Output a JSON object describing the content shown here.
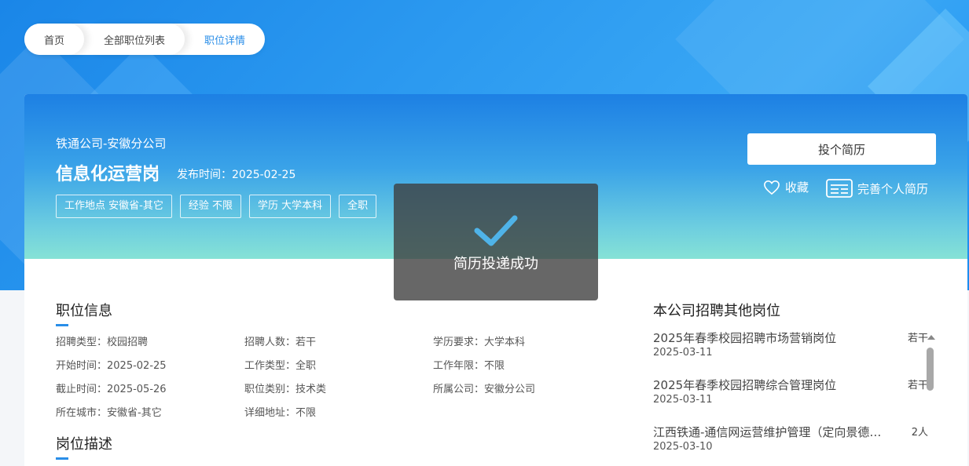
{
  "breadcrumb": {
    "home": "首页",
    "list": "全部职位列表",
    "detail": "职位详情"
  },
  "job": {
    "company": "铁通公司-安徽分公司",
    "title": "信息化运营岗",
    "publish": "发布时间：2025-02-25",
    "tags": [
      "工作地点 安徽省-其它",
      "经验 不限",
      "学历 大学本科",
      "全职"
    ]
  },
  "actions": {
    "apply": "投个简历",
    "favorite": "收藏",
    "resume": "完善个人简历"
  },
  "toast": {
    "text": "简历投递成功",
    "icon": "check-icon"
  },
  "info": {
    "title": "职位信息",
    "cells": [
      "招聘类型：校园招聘",
      "招聘人数：若干",
      "学历要求：大学本科",
      "开始时间：2025-02-25",
      "工作类型：全职",
      "工作年限：不限",
      "截止时间：2025-05-26",
      "职位类别：技术类",
      "所属公司：安徽分公司",
      "所在城市：安徽省-其它",
      "详细地址：不限",
      ""
    ]
  },
  "description": {
    "title": "岗位描述"
  },
  "others": {
    "title": "本公司招聘其他岗位",
    "items": [
      {
        "name": "2025年春季校园招聘市场营销岗位",
        "date": "2025-03-11",
        "count": "若干"
      },
      {
        "name": "2025年春季校园招聘综合管理岗位",
        "date": "2025-03-11",
        "count": "若干"
      },
      {
        "name": "江西铁通-通信网运营维护管理（定向景德镇）",
        "date": "2025-03-10",
        "count": "2人"
      }
    ]
  },
  "colors": {
    "accent": "#2a8ee8",
    "toast_check": "#4fb3e8"
  }
}
